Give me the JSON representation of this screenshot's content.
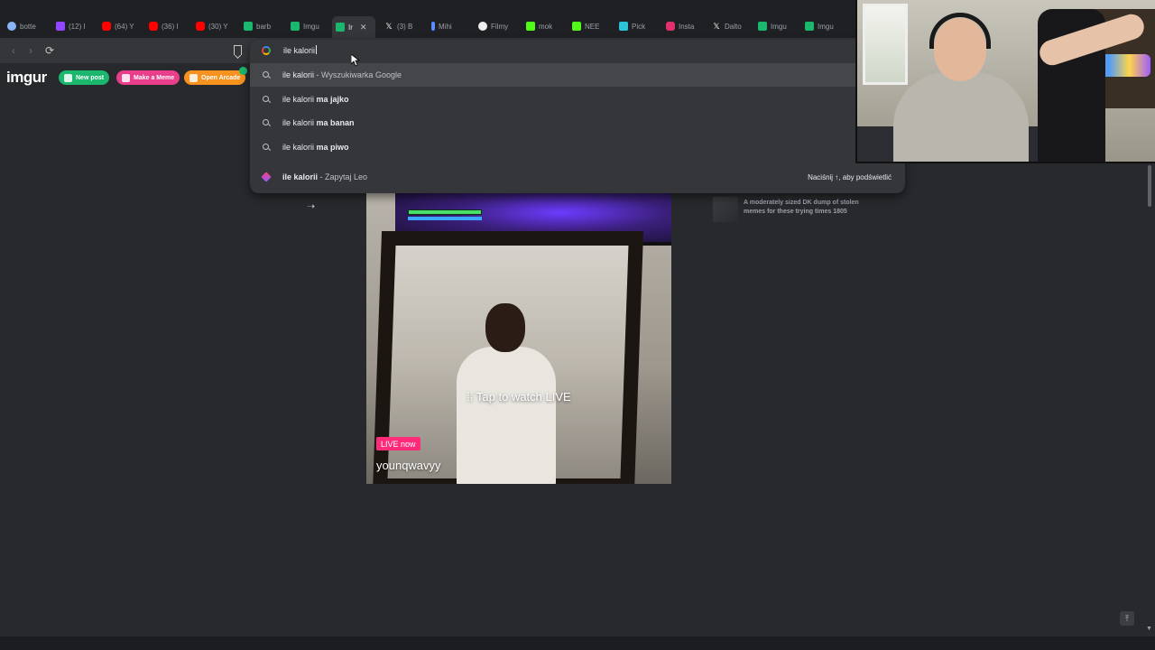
{
  "browser": {
    "tabs": [
      {
        "label": "botte",
        "color": "#8ab4f8"
      },
      {
        "label": "(12) I",
        "color": "#9146ff"
      },
      {
        "label": "(64) Y",
        "color": "#ff0000"
      },
      {
        "label": "(36) I",
        "color": "#ff0000"
      },
      {
        "label": "(30) Y",
        "color": "#ff0000"
      },
      {
        "label": "barb",
        "color": "#1bb76e"
      },
      {
        "label": "Imgu",
        "color": "#1bb76e"
      },
      {
        "label": "Ir",
        "color": "#1bb76e"
      },
      {
        "label": "(3) B",
        "icon": "x"
      },
      {
        "label": "Mihi",
        "color": "#5b8cff"
      },
      {
        "label": "Filmy",
        "color": "#eeeeee"
      },
      {
        "label": "mok",
        "color": "#53fc18"
      },
      {
        "label": "NEE",
        "color": "#53fc18"
      },
      {
        "label": "Pick",
        "color": "#2bc4d6"
      },
      {
        "label": "Insta",
        "color": "#e1306c"
      },
      {
        "label": "Dalto",
        "icon": "x"
      },
      {
        "label": "Imgu",
        "color": "#1bb76e"
      },
      {
        "label": "Imgu",
        "color": "#1bb76e"
      }
    ],
    "omnibox": {
      "value": "ile kalorii"
    },
    "suggestions": [
      {
        "query": "ile kalorii",
        "bold": "",
        "suffix": " - Wyszukiwarka Google"
      },
      {
        "query": "ile kalorii ",
        "bold": "ma jajko",
        "suffix": ""
      },
      {
        "query": "ile kalorii ",
        "bold": "ma banan",
        "suffix": ""
      },
      {
        "query": "ile kalorii ",
        "bold": "ma piwo",
        "suffix": ""
      }
    ],
    "leo_suggestion": {
      "query": "ile kalorii",
      "suffix": " - Zapytaj Leo",
      "hint": "Naciśnij ↑, aby podświetlić"
    }
  },
  "imgur": {
    "logo": "imgur",
    "buttons": {
      "new_post": "New post",
      "make_meme": "Make a Meme",
      "open_arcade": "Open Arcade"
    },
    "colors": {
      "new_post": "#1bb76e",
      "make_meme": "#e83e8c",
      "open_arcade": "#f7921e"
    },
    "related_title": "A moderately sized DK dump of stolen memes for these trying times 1805"
  },
  "video": {
    "overlay_text": "Tap to watch LIVE",
    "live_badge": "LIVE now",
    "username": "younqwavyy"
  }
}
